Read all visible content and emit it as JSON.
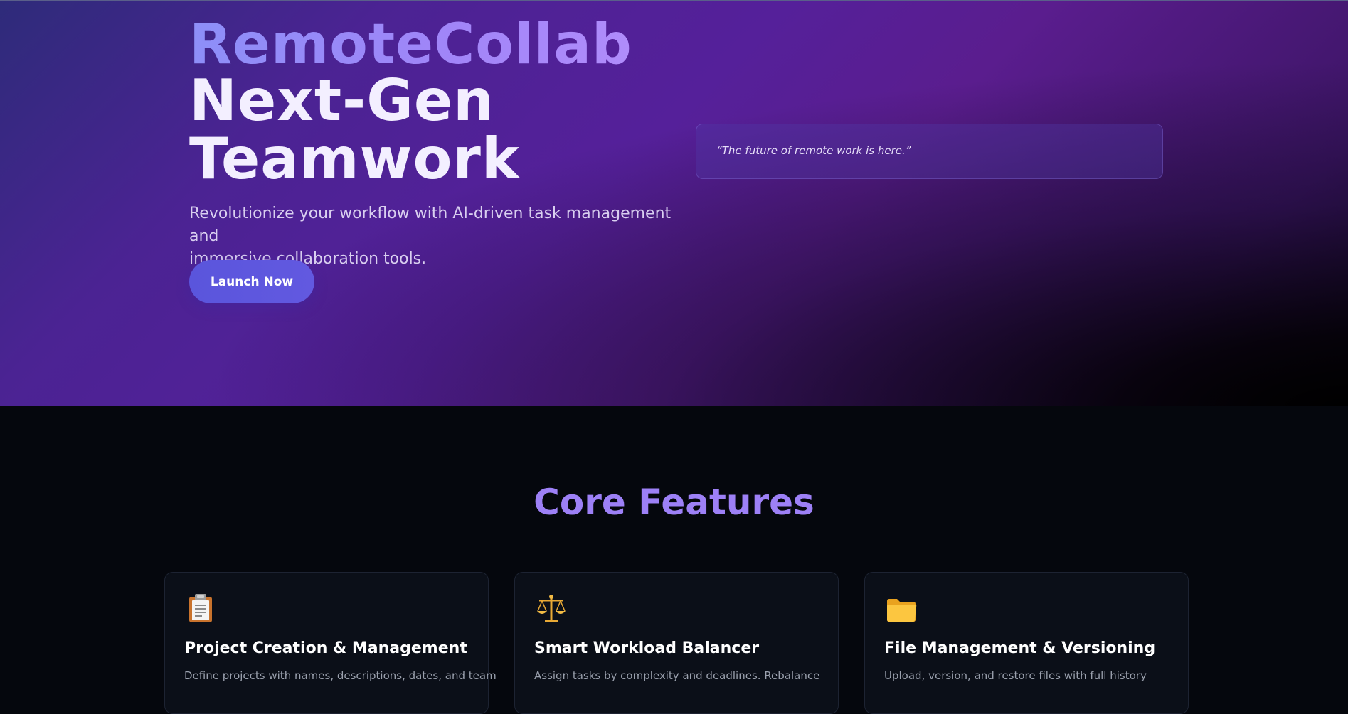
{
  "hero": {
    "brand": "RemoteCollab",
    "headline_line1": "Next-Gen",
    "headline_line2": "Teamwork",
    "tagline_line1": "Revolutionize your workflow with AI-driven task management and",
    "tagline_line2": "immersive collaboration tools.",
    "cta_label": "Launch Now",
    "quote": "“The future of remote work is here.”"
  },
  "features": {
    "title": "Core Features",
    "cards": [
      {
        "icon": "clipboard-icon",
        "title": "Project Creation & Management",
        "desc": "Define projects with names, descriptions, dates, and team"
      },
      {
        "icon": "scales-icon",
        "title": "Smart Workload Balancer",
        "desc": "Assign tasks by complexity and deadlines. Rebalance"
      },
      {
        "icon": "folder-icon",
        "title": "File Management & Versioning",
        "desc": "Upload, version, and restore files with full history"
      }
    ]
  },
  "colors": {
    "accent": "#9d80f6",
    "button": "#5a55dc",
    "hero_purple": "#55209a",
    "background": "#05070d"
  }
}
